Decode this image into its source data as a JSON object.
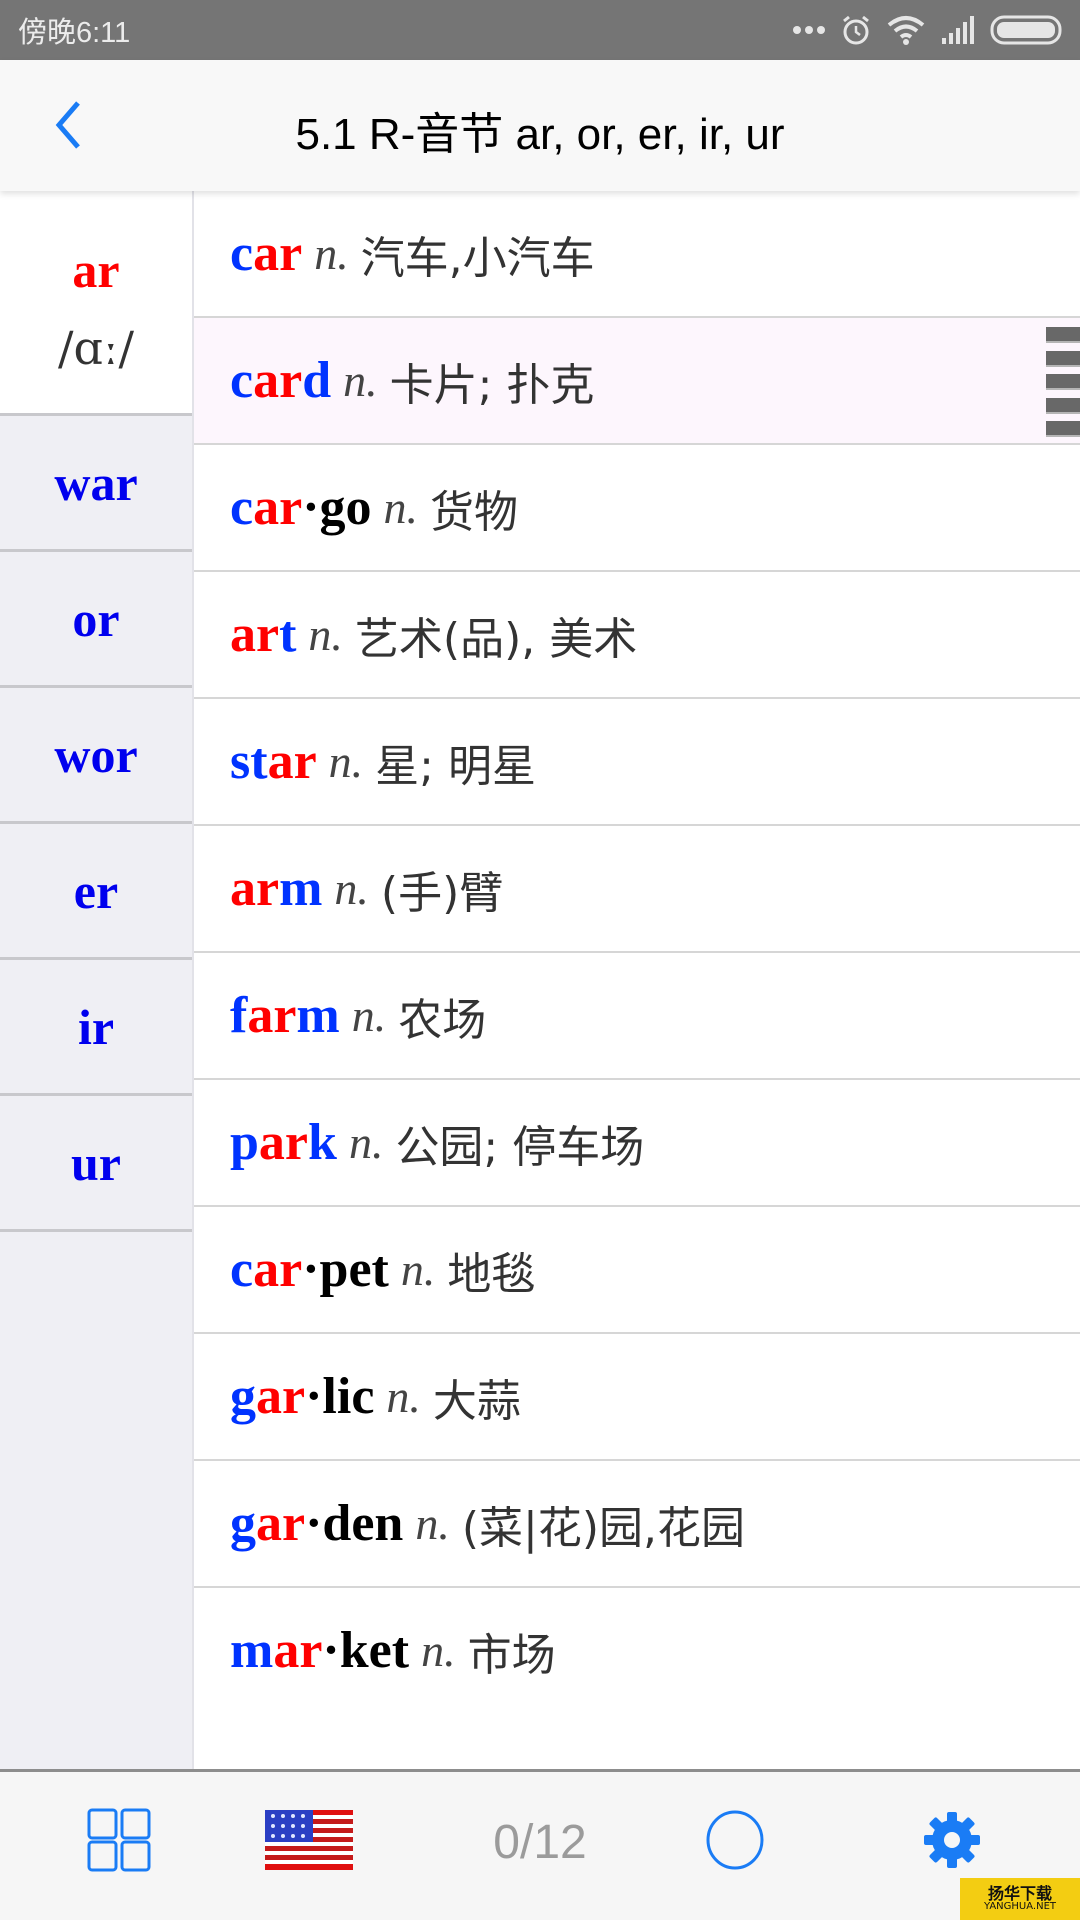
{
  "status_bar": {
    "time": "傍晚6:11",
    "icons": [
      "more-dots-icon",
      "alarm-icon",
      "wifi-icon",
      "signal-icon",
      "battery-icon"
    ]
  },
  "nav": {
    "back_icon": "chevron-left-icon",
    "title": "5.1 R-音节 ar, or, er, ir, ur"
  },
  "colors": {
    "accent": "#1a7cf5",
    "sidebar_active": "#ff0000",
    "sidebar_inactive": "#0000ee",
    "word_blue": "#0033ff",
    "word_red": "#ff0000",
    "word_black": "#000000",
    "highlight_row": "#fdf6fd"
  },
  "sidebar": {
    "items": [
      {
        "label": "ar",
        "ipa": "/ɑː/",
        "active": true
      },
      {
        "label": "war"
      },
      {
        "label": "or"
      },
      {
        "label": "wor"
      },
      {
        "label": "er"
      },
      {
        "label": "ir"
      },
      {
        "label": "ur"
      }
    ]
  },
  "words": [
    {
      "parts": [
        {
          "t": "c",
          "c": "b"
        },
        {
          "t": "ar",
          "c": "r"
        }
      ],
      "pos": "n.",
      "meaning": "汽车,小汽车"
    },
    {
      "parts": [
        {
          "t": "c",
          "c": "b"
        },
        {
          "t": "ar",
          "c": "r"
        },
        {
          "t": "d",
          "c": "b"
        }
      ],
      "pos": "n.",
      "meaning": "卡片; 扑克",
      "highlight": true
    },
    {
      "parts": [
        {
          "t": "c",
          "c": "b"
        },
        {
          "t": "ar",
          "c": "r"
        },
        {
          "t": "·go",
          "c": "k"
        }
      ],
      "pos": "n.",
      "meaning": "货物"
    },
    {
      "parts": [
        {
          "t": "ar",
          "c": "r"
        },
        {
          "t": "t",
          "c": "b"
        }
      ],
      "pos": "n.",
      "meaning": "艺术(品), 美术"
    },
    {
      "parts": [
        {
          "t": "st",
          "c": "b"
        },
        {
          "t": "ar",
          "c": "r"
        }
      ],
      "pos": "n.",
      "meaning": "星; 明星"
    },
    {
      "parts": [
        {
          "t": "ar",
          "c": "r"
        },
        {
          "t": "m",
          "c": "b"
        }
      ],
      "pos": "n.",
      "meaning": "(手)臂"
    },
    {
      "parts": [
        {
          "t": "f",
          "c": "b"
        },
        {
          "t": "ar",
          "c": "r"
        },
        {
          "t": "m",
          "c": "b"
        }
      ],
      "pos": "n.",
      "meaning": "农场"
    },
    {
      "parts": [
        {
          "t": "p",
          "c": "b"
        },
        {
          "t": "ar",
          "c": "r"
        },
        {
          "t": "k",
          "c": "b"
        }
      ],
      "pos": "n.",
      "meaning": "公园; 停车场"
    },
    {
      "parts": [
        {
          "t": "c",
          "c": "b"
        },
        {
          "t": "ar",
          "c": "r"
        },
        {
          "t": "·pet",
          "c": "k"
        }
      ],
      "pos": "n.",
      "meaning": "地毯"
    },
    {
      "parts": [
        {
          "t": "g",
          "c": "b"
        },
        {
          "t": "ar",
          "c": "r"
        },
        {
          "t": "·lic",
          "c": "k"
        }
      ],
      "pos": "n.",
      "meaning": "大蒜"
    },
    {
      "parts": [
        {
          "t": "g",
          "c": "b"
        },
        {
          "t": "ar",
          "c": "r"
        },
        {
          "t": "·den",
          "c": "k"
        }
      ],
      "pos": "n.",
      "meaning": "(菜|花)园,花园"
    },
    {
      "parts": [
        {
          "t": "m",
          "c": "b"
        },
        {
          "t": "ar",
          "c": "r"
        },
        {
          "t": "·ket",
          "c": "k"
        }
      ],
      "pos": "n.",
      "meaning": "市场"
    }
  ],
  "bottom_bar": {
    "grid_icon": "grid-icon",
    "flag_icon": "us-flag-icon",
    "counter": "0/12",
    "circle_icon": "circle-icon",
    "settings_icon": "gear-icon"
  },
  "watermark": {
    "line1": "扬华下载",
    "line2": "YANGHUA.NET"
  }
}
